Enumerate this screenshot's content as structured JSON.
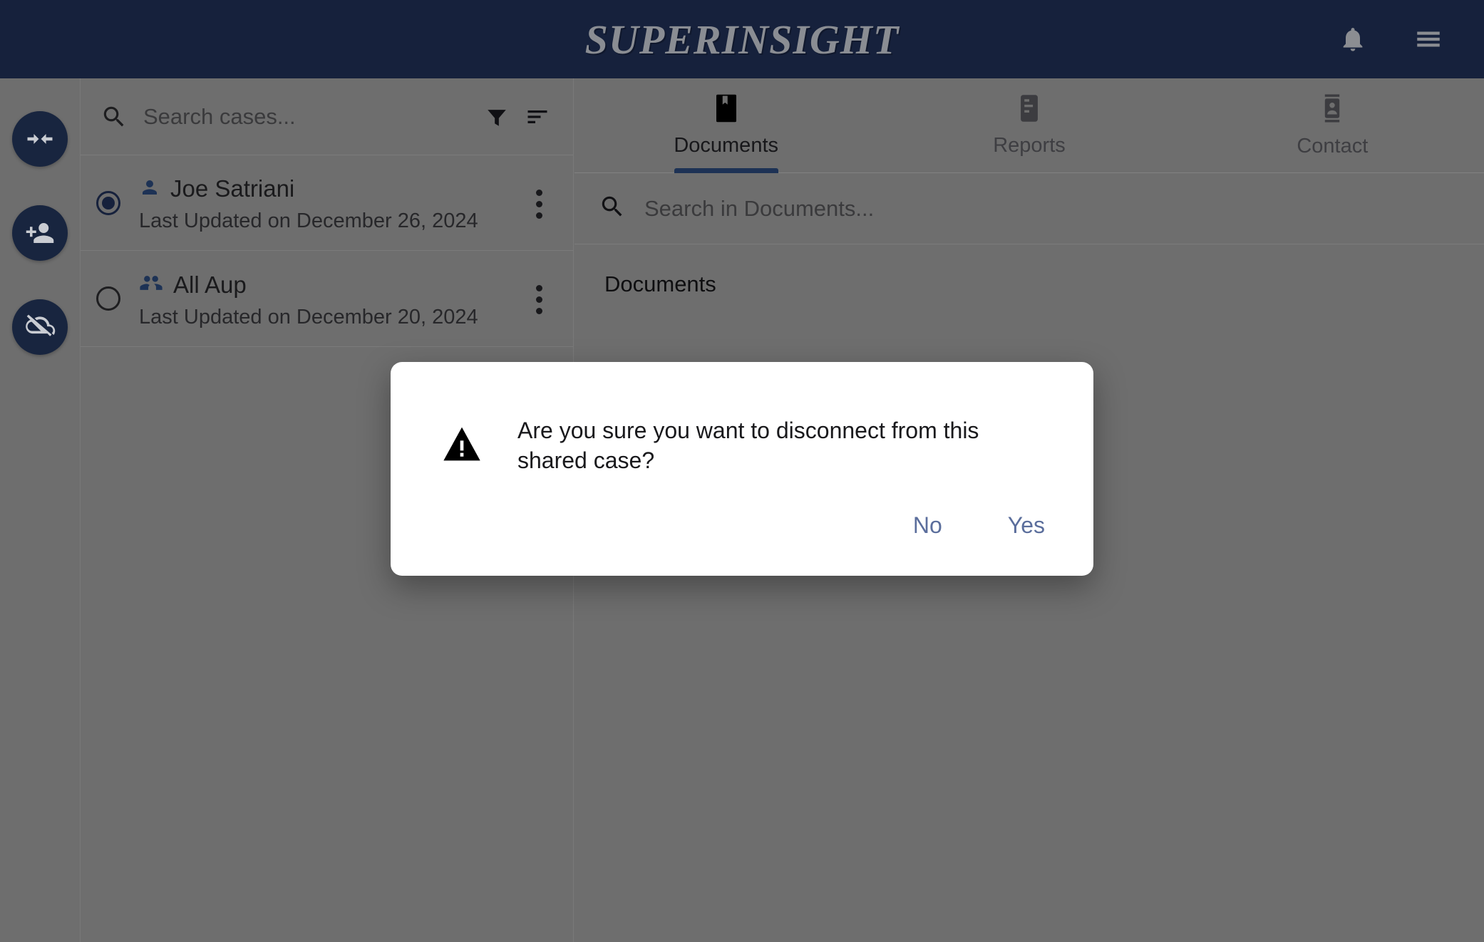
{
  "header": {
    "brand": "SUPERINSIGHT",
    "icons": [
      {
        "name": "notifications-bell-icon",
        "label": "Notifications"
      },
      {
        "name": "hamburger-menu-icon",
        "label": "Menu"
      }
    ]
  },
  "rail": {
    "buttons": [
      {
        "name": "merge-cases-icon",
        "label": "Merge"
      },
      {
        "name": "add-person-icon",
        "label": "Add Contact"
      },
      {
        "name": "cloud-off-icon",
        "label": "Disconnect"
      }
    ]
  },
  "case_list": {
    "search": {
      "value": "",
      "placeholder": "Search cases..."
    },
    "filter_label": "Filter",
    "sort_label": "Sort",
    "items": [
      {
        "title": "Joe Satriani",
        "subtitle": "Last Updated on December 26, 2024",
        "icon": "person-icon",
        "selected": true
      },
      {
        "title": "All Aup",
        "subtitle": "Last Updated on December 20, 2024",
        "icon": "group-icon",
        "selected": false
      }
    ]
  },
  "detail": {
    "tabs": [
      {
        "label": "Documents",
        "icon": "bookmark-document-icon",
        "active": true
      },
      {
        "label": "Reports",
        "icon": "report-summary-icon",
        "active": false
      },
      {
        "label": "Contact",
        "icon": "contact-card-icon",
        "active": false
      }
    ],
    "search": {
      "value": "",
      "placeholder": "Search in Documents..."
    },
    "section_title": "Documents"
  },
  "dialog": {
    "message": "Are you sure you want to disconnect from this shared case?",
    "icon": "warning-triangle-icon",
    "no_label": "No",
    "yes_label": "Yes"
  },
  "colors": {
    "header_bg": "#16213c",
    "page_bg": "#6e6e6e",
    "accent": "#1d3255",
    "dialog_button": "#5b6e9c",
    "brand_text": "#8a8d93"
  }
}
